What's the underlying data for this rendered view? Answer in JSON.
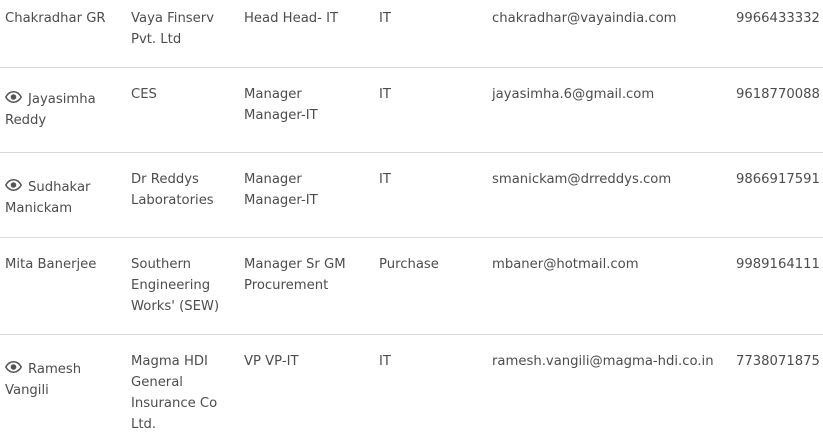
{
  "rows": [
    {
      "name": "Chakradhar GR",
      "has_view_icon": false,
      "company": "Vaya Finserv Pvt. Ltd",
      "designation": "Head Head- IT",
      "department": "IT",
      "email": "chakradhar@vayaindia.com",
      "phone": "9966433332"
    },
    {
      "name": "Jayasimha Reddy",
      "has_view_icon": true,
      "company": "CES",
      "designation": "Manager Manager-IT",
      "department": "IT",
      "email": "jayasimha.6@gmail.com",
      "phone": "9618770088"
    },
    {
      "name": "Sudhakar Manickam",
      "has_view_icon": true,
      "company": "Dr Reddys Laboratories",
      "designation": "Manager Manager-IT",
      "department": "IT",
      "email": "smanickam@drreddys.com",
      "phone": "9866917591"
    },
    {
      "name": "Mita Banerjee",
      "has_view_icon": false,
      "company": "Southern Engineering Works' (SEW)",
      "designation": "Manager Sr GM Procurement",
      "department": "Purchase",
      "email": "mbaner@hotmail.com",
      "phone": "9989164111"
    },
    {
      "name": "Ramesh Vangili",
      "has_view_icon": true,
      "company": "Magma HDI General Insurance Co Ltd.",
      "designation": "VP VP-IT",
      "department": "IT",
      "email": "ramesh.vangili@magma-hdi.co.in",
      "phone": "7738071875"
    }
  ],
  "colors": {
    "text": "#4d4d4d",
    "divider": "#d9d9d9",
    "icon": "#555555"
  },
  "icons": {
    "view": "eye-icon"
  }
}
